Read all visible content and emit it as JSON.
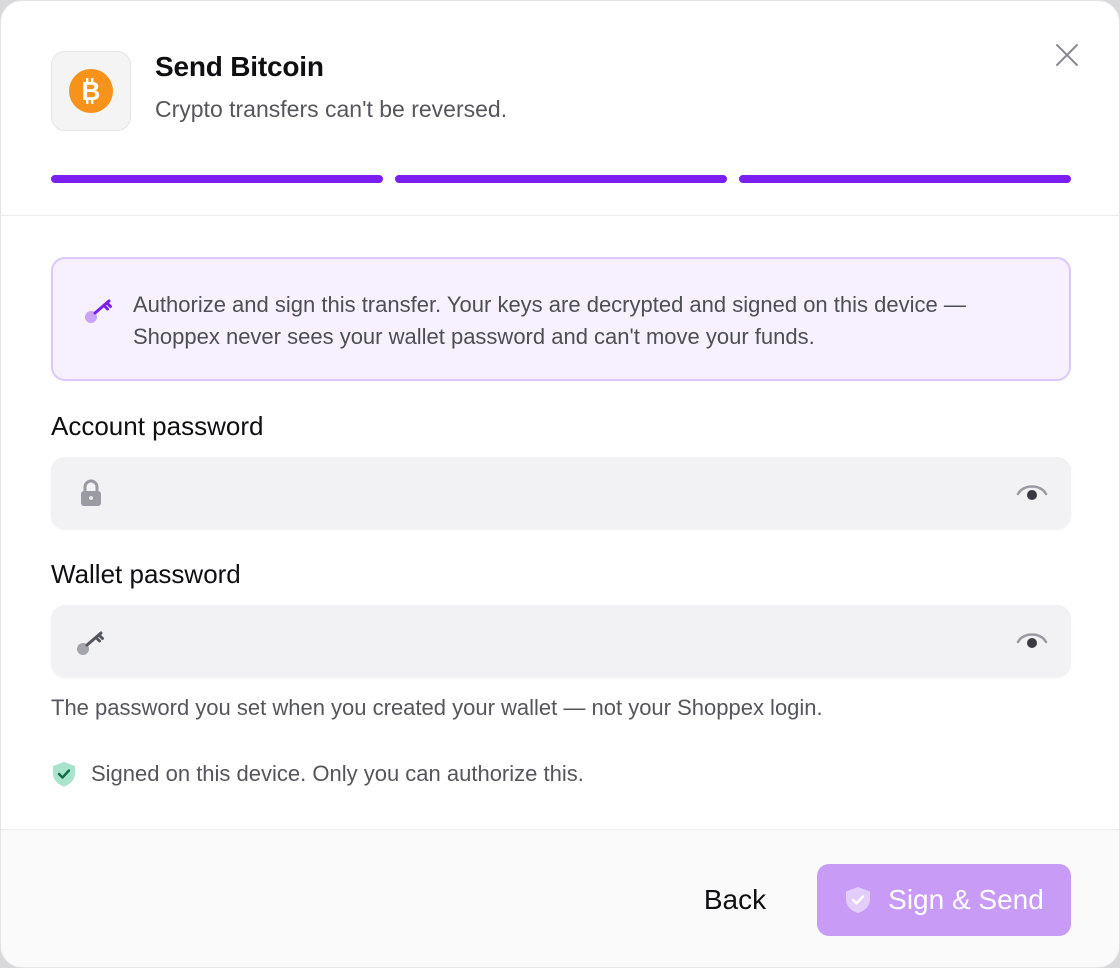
{
  "header": {
    "title": "Send Bitcoin",
    "subtitle": "Crypto transfers can't be reversed.",
    "coin_icon": "bitcoin-icon",
    "progress_steps_total": 3,
    "progress_steps_complete": 3
  },
  "info": {
    "icon": "key-icon",
    "text": "Authorize and sign this transfer. Your keys are decrypted and signed on this device — Shoppex never sees your wallet password and can't move your funds."
  },
  "account_password": {
    "label": "Account password",
    "value": "",
    "placeholder": "",
    "icon": "lock-icon"
  },
  "wallet_password": {
    "label": "Wallet password",
    "value": "",
    "placeholder": "",
    "icon": "key-icon",
    "hint": "The password you set when you created your wallet — not your Shoppex login."
  },
  "security_note": {
    "icon": "shield-check-icon",
    "text": "Signed on this device. Only you can authorize this."
  },
  "footer": {
    "back_label": "Back",
    "send_label": "Sign & Send"
  },
  "colors": {
    "accent": "#7a1ff0",
    "accent_disabled": "#c79bf6",
    "bitcoin": "#f7931a",
    "info_bg": "#f6f0ff",
    "success": "#4fc69a"
  }
}
